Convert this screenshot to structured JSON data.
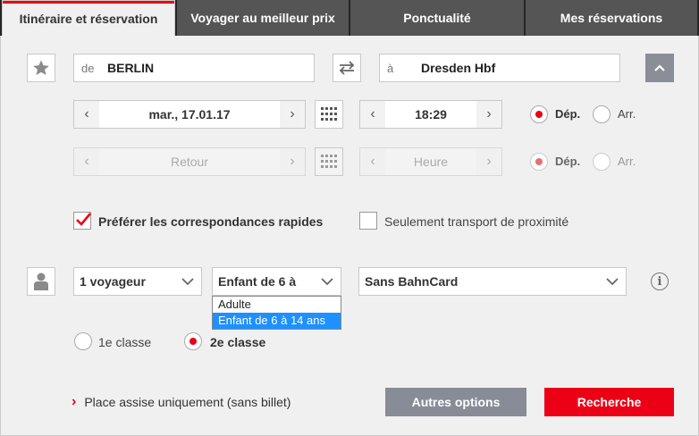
{
  "tabs": [
    {
      "label": "Itinéraire et réservation",
      "active": true
    },
    {
      "label": "Voyager au meilleur prix",
      "active": false
    },
    {
      "label": "Ponctualité",
      "active": false
    },
    {
      "label": "Mes réservations",
      "active": false
    }
  ],
  "route": {
    "from_label": "de",
    "from_value": "BERLIN",
    "to_label": "à",
    "to_value": "Dresden Hbf"
  },
  "outbound": {
    "date": "mar., 17.01.17",
    "time": "18:29",
    "dep_label": "Dép.",
    "arr_label": "Arr.",
    "mode": "dep"
  },
  "return": {
    "date_placeholder": "Retour",
    "time_placeholder": "Heure",
    "dep_label": "Dép.",
    "arr_label": "Arr."
  },
  "options": {
    "fast_connections_label": "Préférer les correspondances rapides",
    "fast_connections_checked": true,
    "local_transport_label": "Seulement transport de proximité",
    "local_transport_checked": false
  },
  "travellers": {
    "count_selected": "1 voyageur",
    "age_selected": "Enfant de 6 à",
    "age_options": [
      "Adulte",
      "Enfant de 6 à 14 ans"
    ],
    "age_highlighted": "Enfant de 6 à 14 ans",
    "bahncard_selected": "Sans BahnCard"
  },
  "class": {
    "first_label": "1e classe",
    "second_label": "2e classe",
    "selected": "2"
  },
  "footer": {
    "seat_only_link": "Place assise uniquement (sans billet)",
    "more_options_label": "Autres options",
    "search_label": "Recherche"
  },
  "colors": {
    "accent": "#ec0016",
    "tab_dark": "#555555",
    "dropdown_highlight": "#1e90ff",
    "secondary_button": "#878c96"
  }
}
